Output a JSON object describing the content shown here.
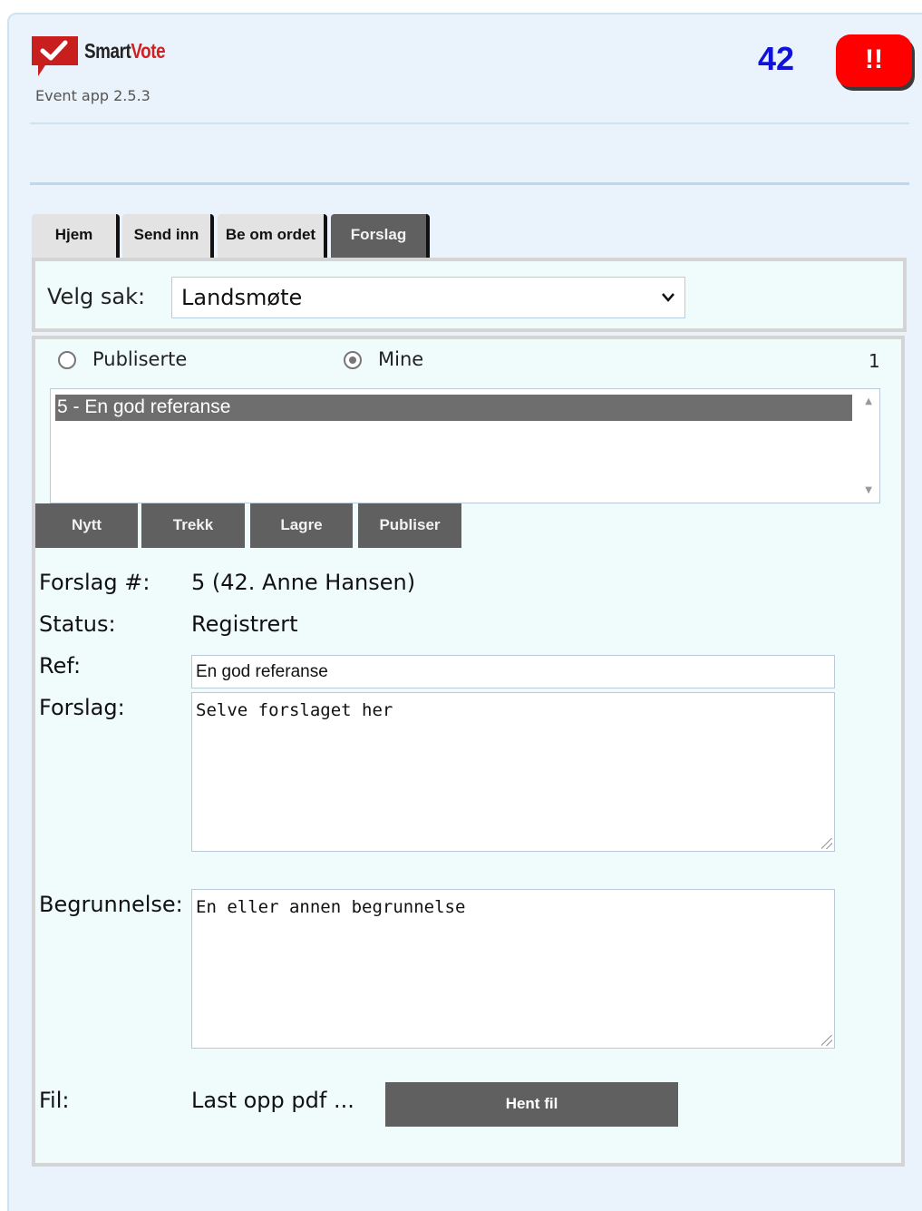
{
  "header": {
    "brand_part1": "Smart",
    "brand_part2": "Vote",
    "version": "Event app 2.5.3",
    "count": "42",
    "alert_label": "!!",
    "logo_icon": "checkmark-speech-bubble-icon",
    "colors": {
      "brand_red": "#d21f1f",
      "count_blue": "#1111dd",
      "alert_red": "#ff0000"
    }
  },
  "tabs": [
    {
      "label": "Hjem",
      "active": false
    },
    {
      "label": "Send inn",
      "active": false
    },
    {
      "label": "Be om ordet",
      "active": false
    },
    {
      "label": "Forslag",
      "active": true
    }
  ],
  "case_select": {
    "label": "Velg sak:",
    "value": "Landsmøte"
  },
  "filter": {
    "option_published": "Publiserte",
    "option_mine": "Mine",
    "selected": "Mine",
    "count": "1"
  },
  "proposals": [
    {
      "label": "5 - En god referanse",
      "selected": true
    }
  ],
  "actions": {
    "new": "Nytt",
    "withdraw": "Trekk",
    "save": "Lagre",
    "publish": "Publiser"
  },
  "details": {
    "number_label": "Forslag #:",
    "number_value": "5 (42. Anne Hansen)",
    "status_label": "Status:",
    "status_value": "Registrert",
    "ref_label": "Ref:",
    "ref_value": "En god referanse",
    "proposal_label": "Forslag:",
    "proposal_value": "Selve forslaget her",
    "reason_label": "Begrunnelse:",
    "reason_value": "En eller annen begrunnelse",
    "file_label": "Fil:",
    "file_value": "Last opp pdf ...",
    "file_button": "Hent fil"
  }
}
